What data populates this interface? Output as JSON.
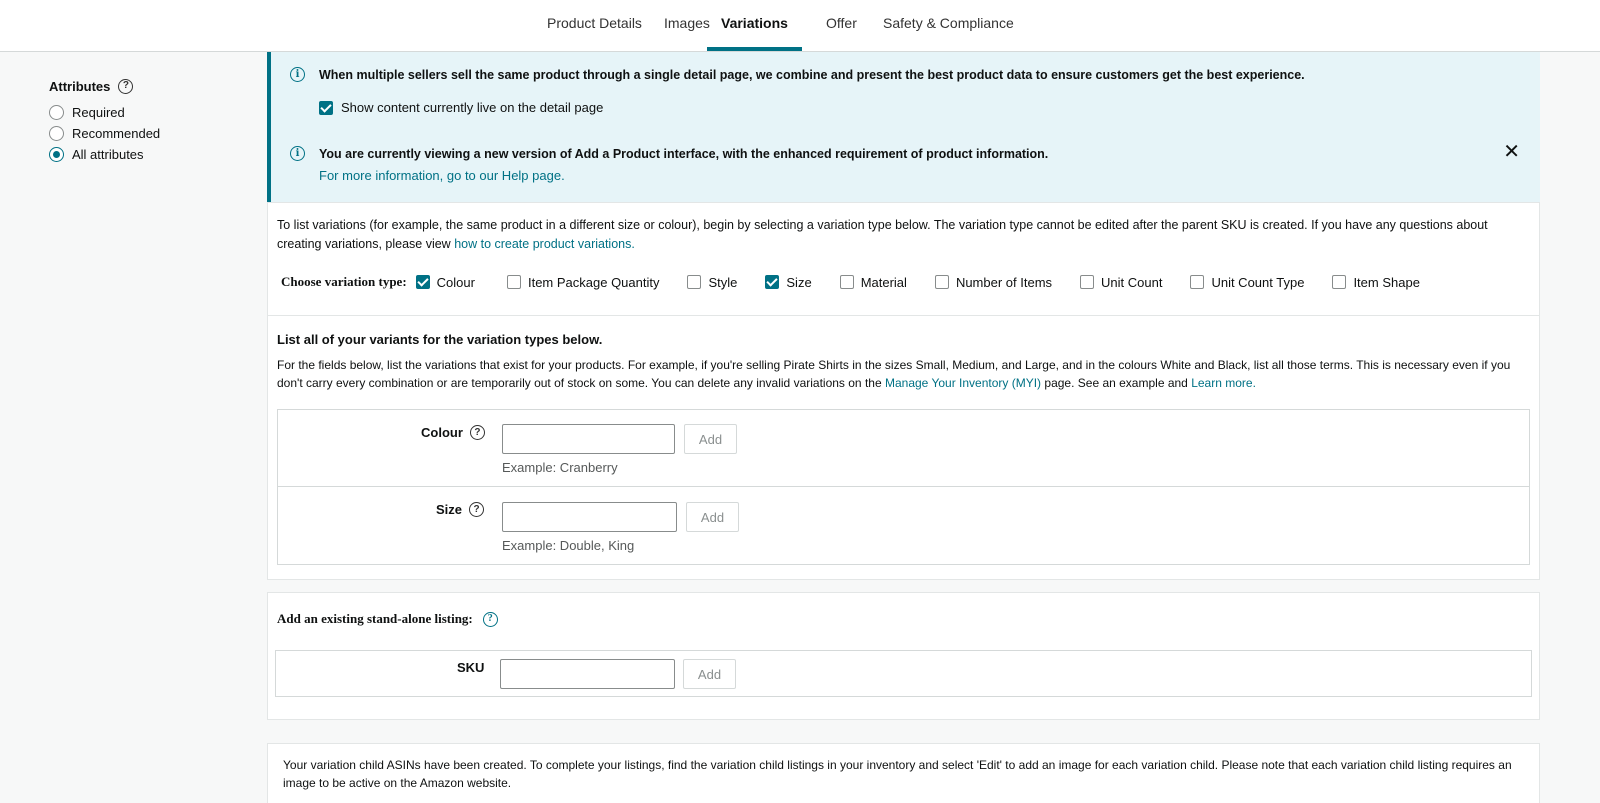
{
  "tabs": [
    {
      "label": "Product Details",
      "active": false
    },
    {
      "label": "Images",
      "active": false
    },
    {
      "label": "Variations",
      "active": true
    },
    {
      "label": "Offer",
      "active": false
    },
    {
      "label": "Safety & Compliance",
      "active": false
    }
  ],
  "sidebar": {
    "title": "Attributes",
    "options": [
      {
        "label": "Required",
        "selected": false
      },
      {
        "label": "Recommended",
        "selected": false
      },
      {
        "label": "All attributes",
        "selected": true
      }
    ]
  },
  "alerts": {
    "first": {
      "text": "When multiple sellers sell the same product through a single detail page, we combine and present the best product data to ensure customers get the best experience.",
      "checkbox_label": "Show content currently live on the detail page",
      "checked": true
    },
    "second": {
      "text": "You are currently viewing a new version of Add a Product interface, with the enhanced requirement of product information.",
      "link": "For more information, go to our Help page."
    }
  },
  "variations": {
    "intro_text": "To list variations (for example, the same product in a different size or colour), begin by selecting a variation type below. The variation type cannot be edited after the parent SKU is created. If you have any questions about creating variations, please view",
    "intro_link": "how to create product variations.",
    "choose_label": "Choose variation type:",
    "types": [
      {
        "label": "Colour",
        "checked": true
      },
      {
        "label": "Item Package Quantity",
        "checked": false
      },
      {
        "label": "Style",
        "checked": false
      },
      {
        "label": "Size",
        "checked": true
      },
      {
        "label": "Material",
        "checked": false
      },
      {
        "label": "Number of Items",
        "checked": false
      },
      {
        "label": "Unit Count",
        "checked": false
      },
      {
        "label": "Unit Count Type",
        "checked": false
      },
      {
        "label": "Item Shape",
        "checked": false
      }
    ],
    "list_title": "List all of your variants for the variation types below.",
    "list_desc_1": "For the fields below, list the variations that exist for your products. For example, if you're selling Pirate Shirts in the sizes Small, Medium, and Large, and in the colours White and Black, list all those terms. This is necessary even if you don't carry every combination or are temporarily out of stock on some. You can delete any invalid variations on the",
    "list_desc_link_1": "Manage Your Inventory (MYI)",
    "list_desc_2": "page. See an example and",
    "list_desc_link_2": "Learn more.",
    "fields": [
      {
        "label": "Colour",
        "value": "",
        "button": "Add",
        "example": "Example: Cranberry"
      },
      {
        "label": "Size",
        "value": "",
        "button": "Add",
        "example": "Example: Double, King"
      }
    ]
  },
  "standalone": {
    "title": "Add an existing stand-alone listing:",
    "sku_label": "SKU",
    "sku_value": "",
    "button": "Add"
  },
  "notice": "Your variation child ASINs have been created. To complete your listings, find the variation child listings in your inventory and select 'Edit' to add an image for each variation child. Please note that each variation child listing requires an image to be active on the Amazon website."
}
